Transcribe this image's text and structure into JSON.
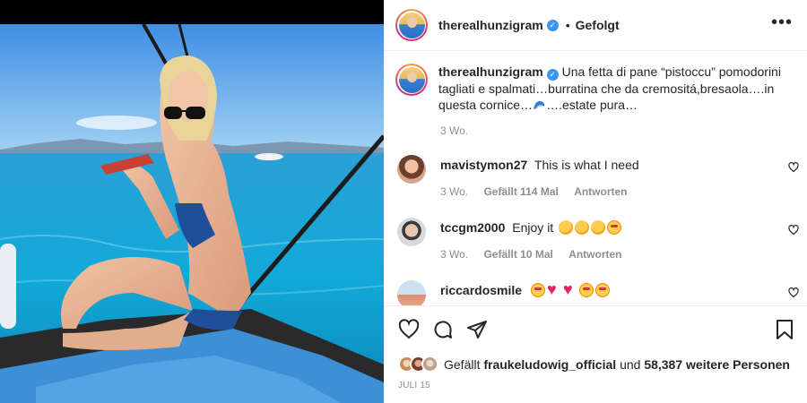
{
  "header": {
    "username": "therealhunzigram",
    "separator": "•",
    "follow_status": "Gefolgt",
    "more_glyph": "•••"
  },
  "caption": {
    "username": "therealhunzigram",
    "text_part1": "Una fetta di pane “pistoccu” pomodorini tagliati e spalmati…burratina che da cremositá,bresaola….in questa cornice…",
    "text_part2": "….estate pura…",
    "emoji": "wave-emoji",
    "age": "3 Wo."
  },
  "comments": [
    {
      "username": "mavistymon27",
      "text": "This is what I need",
      "age": "3 Wo.",
      "likes": "Gefällt 114 Mal",
      "reply": "Antworten"
    },
    {
      "username": "tccgm2000",
      "text": "Enjoy it",
      "emojis": [
        "clap",
        "clap",
        "clap",
        "face"
      ],
      "age": "3 Wo.",
      "likes": "Gefällt 10 Mal",
      "reply": "Antworten"
    },
    {
      "username": "riccardosmile",
      "text": "",
      "emojis": [
        "face",
        "heart",
        "heart",
        "face",
        "face"
      ]
    }
  ],
  "likes": {
    "prefix": "Gefällt",
    "user": "fraukeludowig_official",
    "conjunction": "und",
    "count": "58,387 weitere Personen"
  },
  "post_date": "JULI 15",
  "icons": {
    "like": "heart-icon",
    "comment": "comment-icon",
    "share": "share-icon",
    "save": "bookmark-icon"
  },
  "colors": {
    "verified": "#3897f0",
    "secondary_text": "#8e8e8e",
    "border": "#efefef"
  }
}
